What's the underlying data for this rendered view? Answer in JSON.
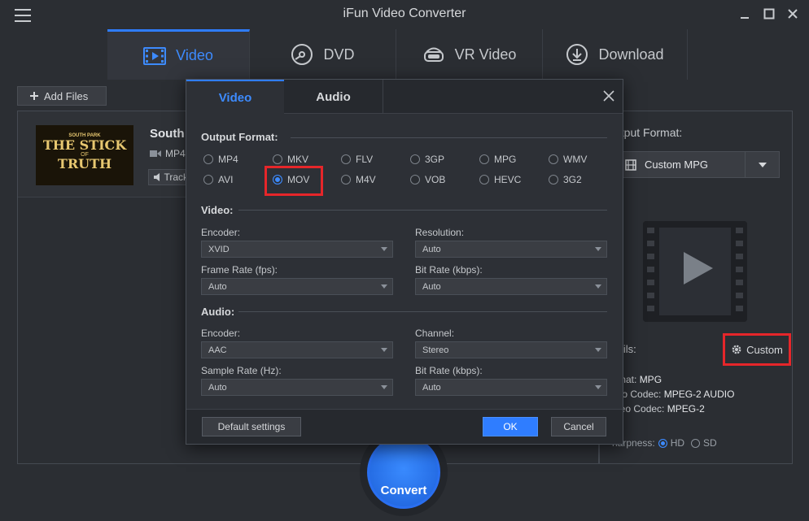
{
  "app": {
    "title": "iFun Video Converter"
  },
  "main_tabs": [
    {
      "label": "Video",
      "icon": "video-icon",
      "active": true
    },
    {
      "label": "DVD",
      "icon": "disc-icon",
      "active": false
    },
    {
      "label": "VR Video",
      "icon": "vr-headset-icon",
      "active": false
    },
    {
      "label": "Download",
      "icon": "download-icon",
      "active": false
    }
  ],
  "toolbar": {
    "add_files_label": "Add Files"
  },
  "file_item": {
    "name": "South",
    "format": "MP4",
    "track_label": "Track",
    "thumbnail_text": {
      "line1": "SOUTH PARK",
      "line2": "THE STICK",
      "line3": "OF",
      "line4": "TRUTH"
    }
  },
  "output_panel": {
    "format_label": "utput Format:",
    "selected_format": "Custom MPG",
    "details_label": "tails:",
    "custom_label": "Custom",
    "details": [
      {
        "label": "rmat:",
        "value": "MPG"
      },
      {
        "label": "dio Codec:",
        "value": "MPEG-2 AUDIO"
      },
      {
        "label": "deo Codec:",
        "value": "MPEG-2"
      }
    ],
    "sharpness_label": "harpness:",
    "sharpness_options": [
      {
        "label": "HD",
        "selected": true
      },
      {
        "label": "SD",
        "selected": false
      }
    ]
  },
  "convert": {
    "label": "Convert"
  },
  "dialog": {
    "tabs": [
      {
        "label": "Video",
        "active": true
      },
      {
        "label": "Audio",
        "active": false
      }
    ],
    "output_format_title": "Output Format:",
    "formats": [
      {
        "label": "MP4",
        "selected": false
      },
      {
        "label": "MKV",
        "selected": false
      },
      {
        "label": "FLV",
        "selected": false
      },
      {
        "label": "3GP",
        "selected": false
      },
      {
        "label": "MPG",
        "selected": false
      },
      {
        "label": "WMV",
        "selected": false
      },
      {
        "label": "AVI",
        "selected": false
      },
      {
        "label": "MOV",
        "selected": true
      },
      {
        "label": "M4V",
        "selected": false
      },
      {
        "label": "VOB",
        "selected": false
      },
      {
        "label": "HEVC",
        "selected": false
      },
      {
        "label": "3G2",
        "selected": false
      }
    ],
    "video_section": {
      "title": "Video:",
      "encoder_label": "Encoder:",
      "encoder_value": "XVID",
      "resolution_label": "Resolution:",
      "resolution_value": "Auto",
      "framerate_label": "Frame Rate (fps):",
      "framerate_value": "Auto",
      "bitrate_label": "Bit Rate (kbps):",
      "bitrate_value": "Auto"
    },
    "audio_section": {
      "title": "Audio:",
      "encoder_label": "Encoder:",
      "encoder_value": "AAC",
      "channel_label": "Channel:",
      "channel_value": "Stereo",
      "samplerate_label": "Sample Rate (Hz):",
      "samplerate_value": "Auto",
      "bitrate_label": "Bit Rate (kbps):",
      "bitrate_value": "Auto"
    },
    "footer": {
      "default_label": "Default settings",
      "ok_label": "OK",
      "cancel_label": "Cancel"
    }
  },
  "colors": {
    "accent": "#2f7dff",
    "highlight": "#e6262a",
    "background": "#2b2e33"
  }
}
